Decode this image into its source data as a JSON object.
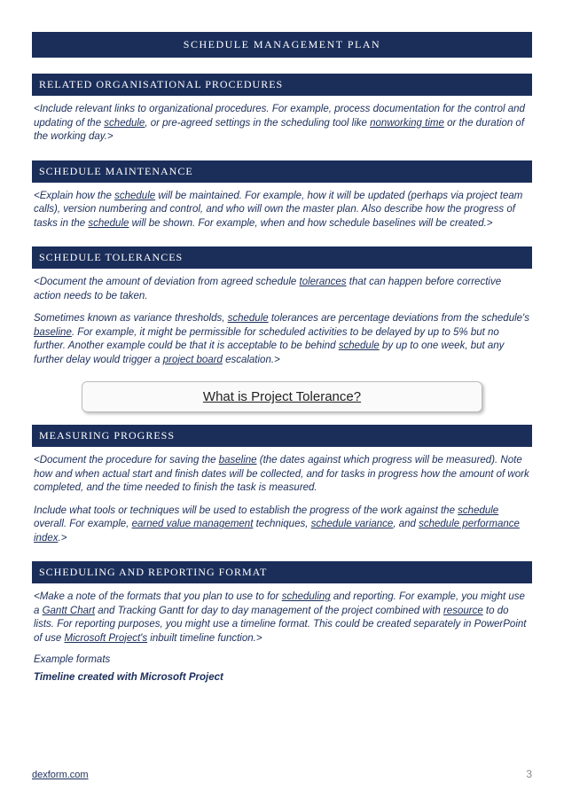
{
  "title": "SCHEDULE MANAGEMENT PLAN",
  "sections": {
    "s1": {
      "heading": "RELATED ORGANISATIONAL PROCEDURES",
      "p1a": "<Include relevant links to organizational procedures. For example, process documentation for the control and updating of the ",
      "p1_link1": "schedule",
      "p1b": ", or pre-agreed settings in the scheduling tool like ",
      "p1_link2": "nonworking time",
      "p1c": " or the duration of the working day.>"
    },
    "s2": {
      "heading": "SCHEDULE MAINTENANCE",
      "p1a": "<Explain how the ",
      "p1_link1": "schedule",
      "p1b": " will be maintained. For example, how it will be updated (perhaps via project team calls), version numbering and control, and who will own the master plan. Also describe how the progress of tasks in the ",
      "p1_link2": "schedule",
      "p1c": " will be shown. For example, when and how schedule baselines will be created.>"
    },
    "s3": {
      "heading": "SCHEDULE TOLERANCES",
      "p1a": "<Document the amount of deviation from agreed schedule ",
      "p1_link1": "tolerances",
      "p1b": " that can happen before corrective action needs to be taken.",
      "p2a": "Sometimes known as variance thresholds, ",
      "p2_link1": "schedule",
      "p2b": " tolerances are percentage deviations from the schedule's ",
      "p2_link2": "baseline",
      "p2c": ". For example, it might be permissible for scheduled activities to be delayed by up to 5% but no further. Another example could be that it is acceptable to be behind ",
      "p2_link3": "schedule",
      "p2d": " by up to one week, but any further delay would trigger a ",
      "p2_link4": "project board",
      "p2e": " escalation.>",
      "callout": "What is Project Tolerance?"
    },
    "s4": {
      "heading": "MEASURING PROGRESS",
      "p1a": "<Document the procedure for saving the ",
      "p1_link1": "baseline",
      "p1b": " (the dates against which progress will be measured). Note how and when actual start and finish dates will be collected, and for tasks in progress how the amount of work completed, and the time needed to finish the task is measured.",
      "p2a": "Include what tools or techniques will be used to establish the progress of the work against the ",
      "p2_link1": "schedule",
      "p2b": " overall. For example, ",
      "p2_link2": "earned value management",
      "p2c": " techniques, ",
      "p2_link3": "schedule variance",
      "p2d": ", and ",
      "p2_link4": "schedule performance index",
      "p2e": ".>"
    },
    "s5": {
      "heading": "SCHEDULING AND REPORTING FORMAT",
      "p1a": "<Make a note of the formats that you plan to use to for ",
      "p1_link1": "scheduling",
      "p1b": " and reporting. For example, you might use a ",
      "p1_link2": "Gantt Chart",
      "p1c": " and Tracking Gantt for day to day management of the project combined with ",
      "p1_link3": "resource",
      "p1d": " to do lists. For reporting purposes, you might use a timeline format. This could be created separately in PowerPoint of use ",
      "p1_link4": "Microsoft Project's",
      "p1e": " inbuilt timeline function.>",
      "subhead": "Example formats",
      "bold": "Timeline created with Microsoft Project"
    }
  },
  "footer": {
    "site": "dexform.com",
    "page": "3"
  }
}
